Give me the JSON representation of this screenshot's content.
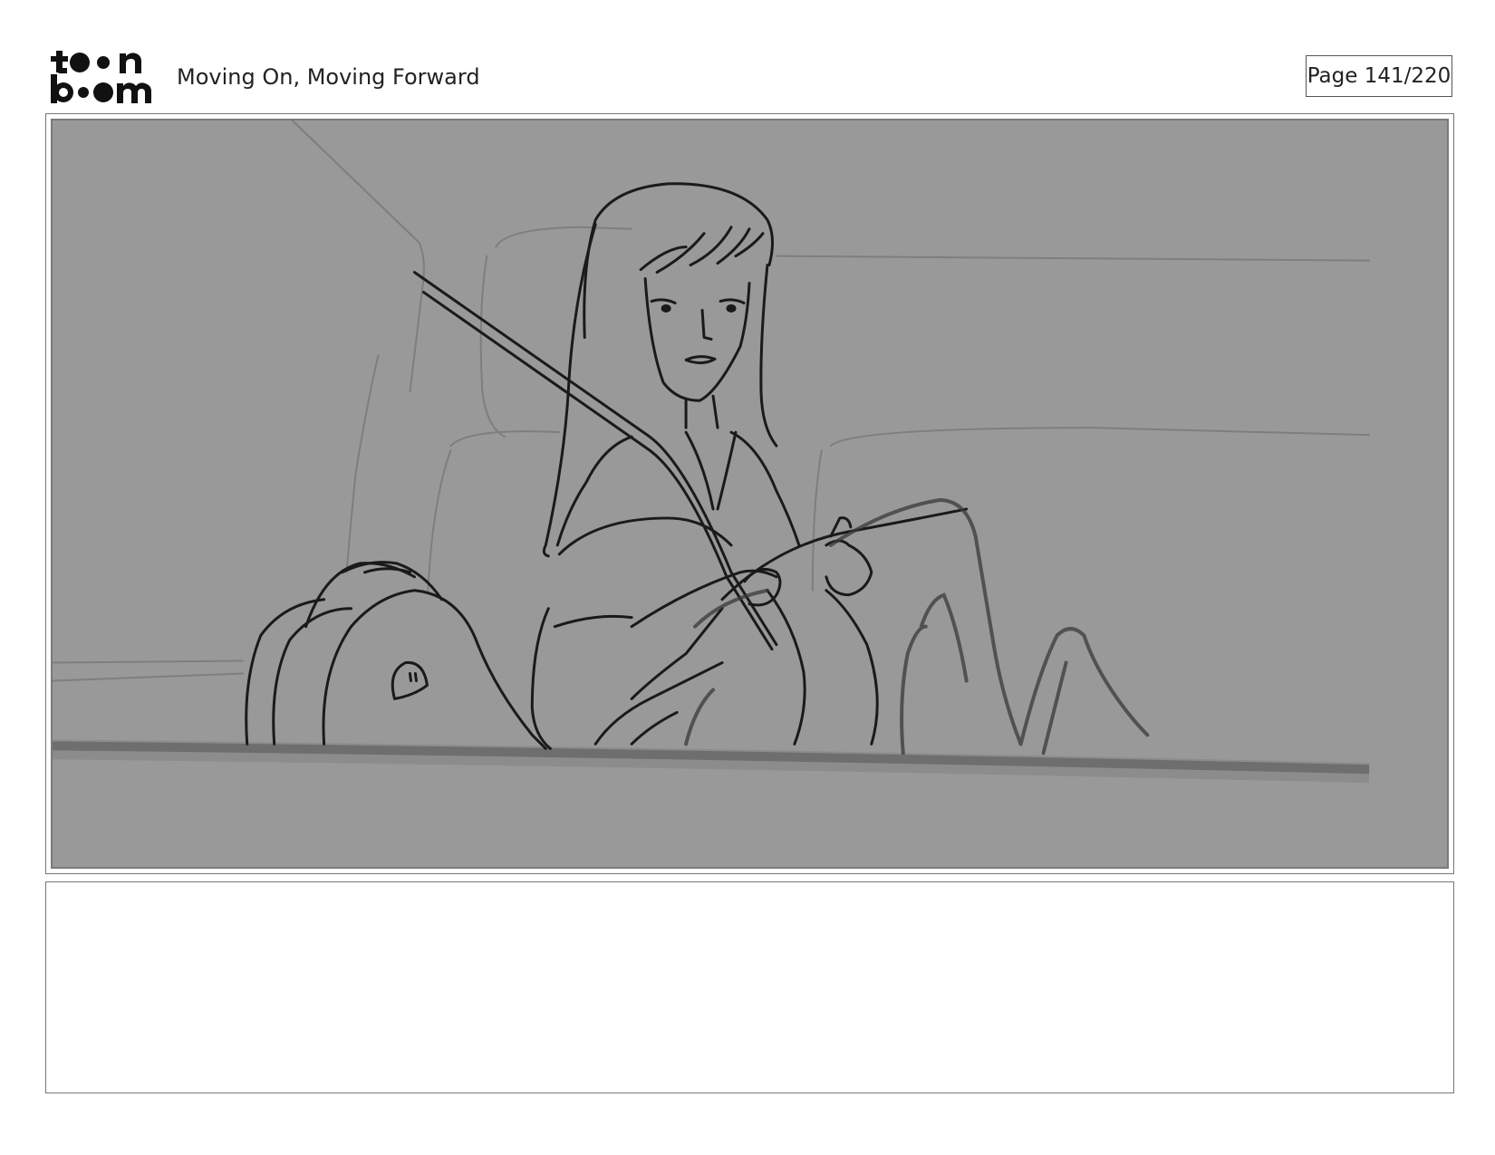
{
  "header": {
    "logo_text": "toon boom",
    "title": "Moving On, Moving Forward",
    "page_label": "Page 141/220"
  },
  "panel": {
    "background_color": "#999999",
    "line_color": "#1a1a1a",
    "guide_color": "#7e7e7e"
  },
  "notes": {
    "text": ""
  }
}
